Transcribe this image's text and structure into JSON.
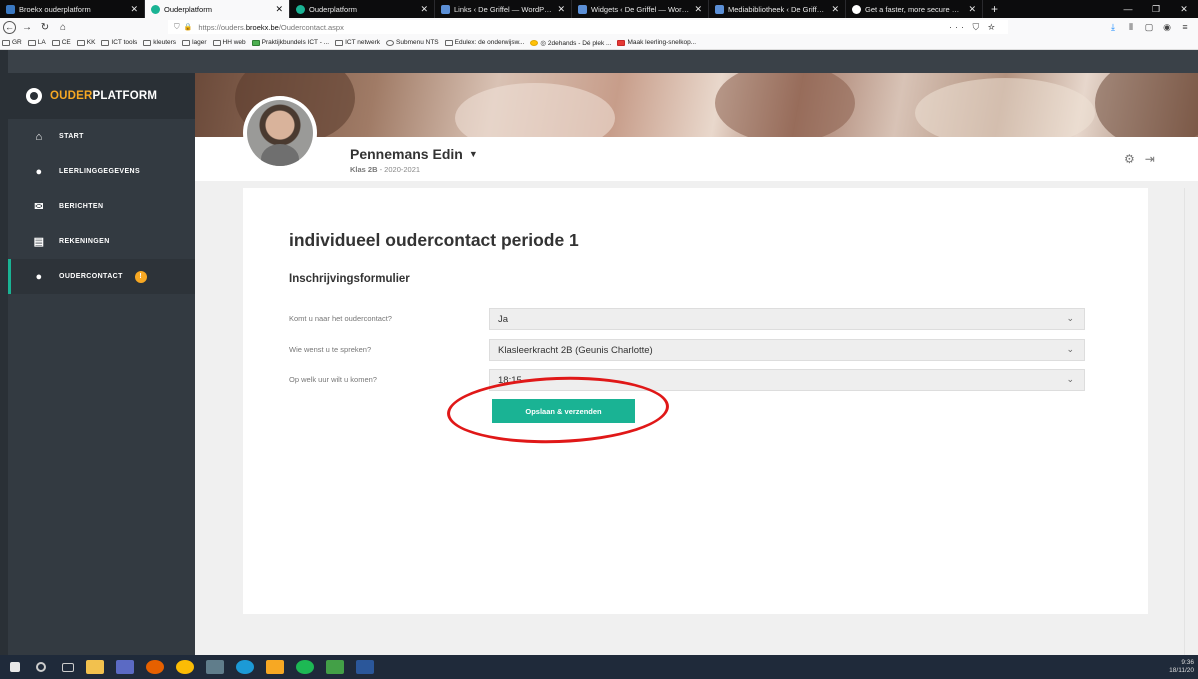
{
  "browser": {
    "tabs": [
      {
        "label": "Broekx ouderplatform",
        "color": "#3a78c2",
        "active": false
      },
      {
        "label": "Ouderplatform",
        "color": "#1ab394",
        "active": true
      },
      {
        "label": "Ouderplatform",
        "color": "#1ab394",
        "active": false
      },
      {
        "label": "Links ‹ De Griffel — WordPress",
        "color": "#5b8fd6",
        "active": false
      },
      {
        "label": "Widgets ‹ De Griffel — WordPre",
        "color": "#5b8fd6",
        "active": false
      },
      {
        "label": "Mediabibliotheek ‹ De Griffel —",
        "color": "#5b8fd6",
        "active": false
      },
      {
        "label": "Get a faster, more secure websi",
        "color": "#ffffff",
        "active": false
      }
    ],
    "url_prefix": "https://ouders.",
    "url_host": "broekx.be",
    "url_path": "/Oudercontact.aspx",
    "bookmarks": [
      "GR",
      "LA",
      "CE",
      "KK",
      "ICT tools",
      "kleuters",
      "lager",
      "HH web",
      "Praktijkbundels ICT - ...",
      "ICT netwerk",
      "Submenu NTS",
      "Edulex: de onderwijsw...",
      "◎ 2dehands - Dé plek ...",
      "Maak leerling-snelkop..."
    ]
  },
  "sidebar": {
    "logo_part1": "OUDER",
    "logo_part2": "PLATFORM",
    "items": [
      {
        "label": "START",
        "icon": "home-icon",
        "glyph": "⌂",
        "active": false
      },
      {
        "label": "LEERLINGGEGEVENS",
        "icon": "user-icon",
        "glyph": "●",
        "active": false
      },
      {
        "label": "BERICHTEN",
        "icon": "envelope-icon",
        "glyph": "✉",
        "active": false
      },
      {
        "label": "REKENINGEN",
        "icon": "document-icon",
        "glyph": "▤",
        "active": false
      },
      {
        "label": "OUDERCONTACT",
        "icon": "users-icon",
        "glyph": "●",
        "active": true,
        "badge": "!"
      }
    ]
  },
  "header": {
    "student_name": "Pennemans Edin",
    "class_label": "Klas 2B",
    "school_year": " - 2020-2021"
  },
  "main": {
    "page_title": "individueel oudercontact periode 1",
    "form_title": "Inschrijvingsformulier",
    "fields": [
      {
        "label": "Komt u naar het oudercontact?",
        "value": "Ja"
      },
      {
        "label": "Wie wenst u te spreken?",
        "value": "Klasleerkracht 2B (Geunis Charlotte)"
      },
      {
        "label": "Op welk uur wilt u komen?",
        "value": "18:15"
      }
    ],
    "submit_label": "Opslaan & verzenden"
  },
  "taskbar": {
    "time": "9:36",
    "date": "18/11/20"
  },
  "colors": {
    "accent": "#1ab394",
    "brand_orange": "#f7a823",
    "sidebar_bg": "#333a41",
    "highlight": "#e01818"
  }
}
